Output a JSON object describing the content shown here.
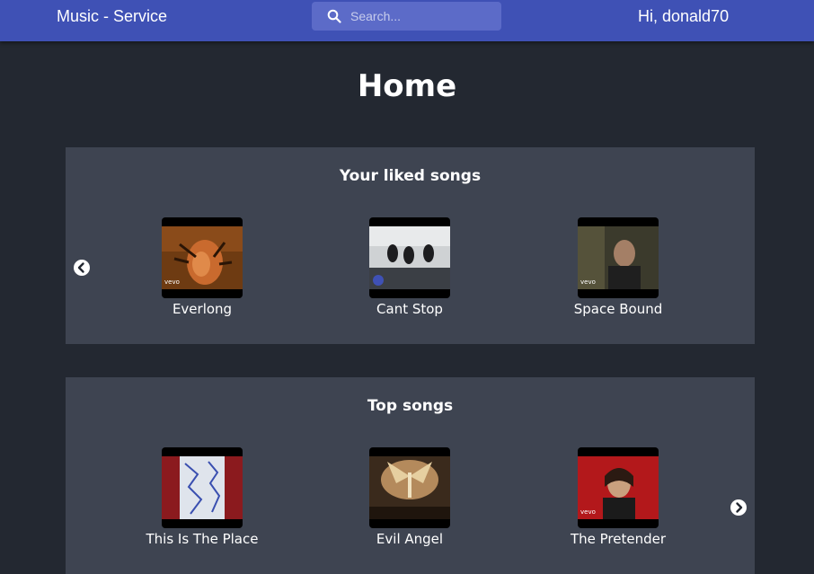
{
  "header": {
    "brand": "Music - Service",
    "search_placeholder": "Search...",
    "greeting": "Hi, donald70"
  },
  "page": {
    "title": "Home"
  },
  "liked": {
    "title": "Your liked songs",
    "songs": [
      {
        "title": "Everlong",
        "badge": "vevo"
      },
      {
        "title": "Cant Stop",
        "badge": ""
      },
      {
        "title": "Space Bound",
        "badge": "vevo"
      }
    ]
  },
  "top": {
    "title": "Top songs",
    "songs": [
      {
        "title": "This Is The Place",
        "badge": ""
      },
      {
        "title": "Evil Angel",
        "badge": ""
      },
      {
        "title": "The Pretender",
        "badge": "vevo"
      }
    ]
  },
  "icons": {
    "search": "search-icon",
    "prev": "chevron-left-icon",
    "next": "chevron-right-icon"
  },
  "colors": {
    "header_bg": "#3f51b5",
    "page_bg": "#232831",
    "panel_bg": "#3e4451"
  }
}
